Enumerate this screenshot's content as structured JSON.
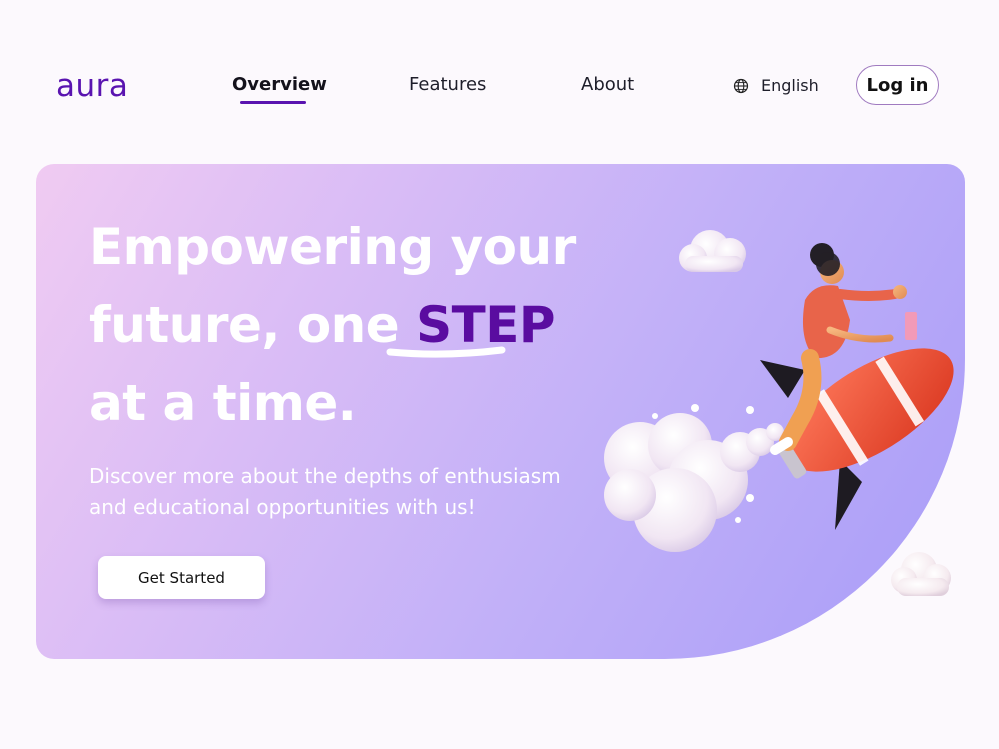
{
  "brand": {
    "logo_text": "aura",
    "accent": "#5a14b0"
  },
  "nav": {
    "items": [
      {
        "label": "Overview",
        "active": true
      },
      {
        "label": "Features",
        "active": false
      },
      {
        "label": "About",
        "active": false
      }
    ],
    "language": {
      "label": "English",
      "icon": "globe-icon"
    },
    "login_label": "Log in"
  },
  "hero": {
    "headline_line1": "Empowering your",
    "headline_line2_prefix": "future, one ",
    "headline_highlight": "STEP",
    "headline_line3": "at a time.",
    "subtext_line1": "Discover more about the depths of enthusiasm",
    "subtext_line2": "and educational opportunities with us!",
    "cta_label": "Get Started",
    "highlight_color": "#5a0ca0",
    "illustration": "person-riding-rocket-with-clouds"
  }
}
